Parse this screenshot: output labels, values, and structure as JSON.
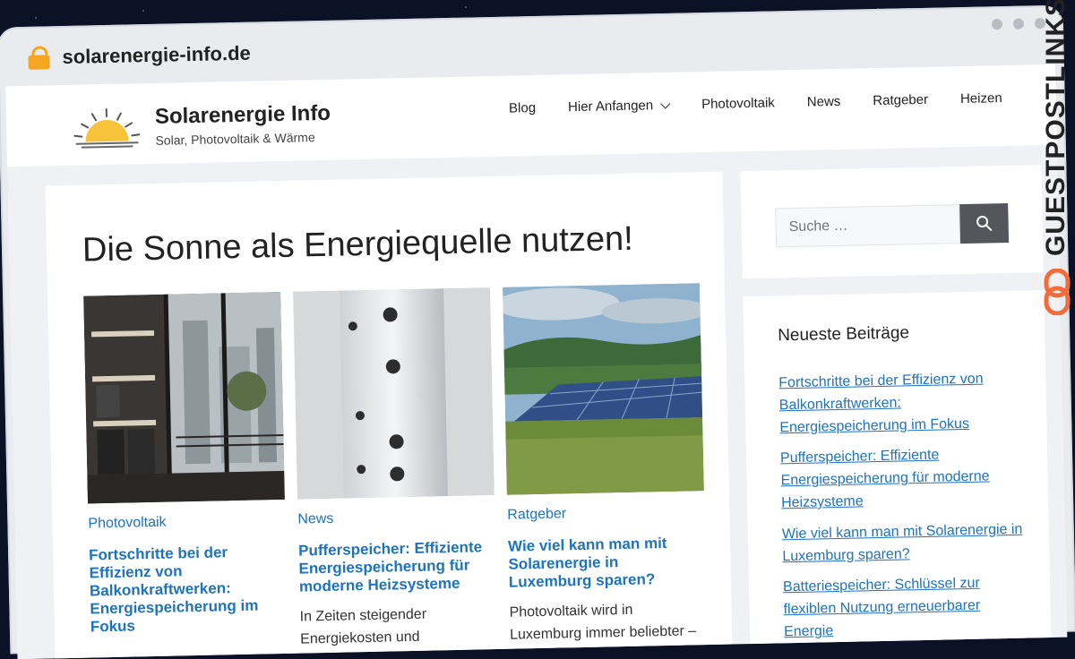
{
  "browser": {
    "url": "solarenergie-info.de"
  },
  "header": {
    "site_title": "Solarenergie Info",
    "site_description": "Solar, Photovoltaik & Wärme",
    "nav": [
      {
        "label": "Blog"
      },
      {
        "label": "Hier Anfangen",
        "has_dropdown": true
      },
      {
        "label": "Photovoltaik"
      },
      {
        "label": "News"
      },
      {
        "label": "Ratgeber"
      },
      {
        "label": "Heizen"
      }
    ]
  },
  "main": {
    "page_title": "Die Sonne als Energiequelle nutzen!",
    "posts": [
      {
        "category": "Photovoltaik",
        "title": "Fortschritte bei der Effizienz von Balkonkraftwerken: Energiespeicherung im Fokus",
        "excerpt": ""
      },
      {
        "category": "News",
        "title": "Pufferspeicher: Effiziente Energiespeicherung für moderne Heizsysteme",
        "excerpt": "In Zeiten steigender Energiekosten und"
      },
      {
        "category": "Ratgeber",
        "title": "Wie viel kann man mit Solarenergie in Luxemburg sparen?",
        "excerpt": "Photovoltaik wird in Luxemburg immer beliebter –"
      }
    ]
  },
  "sidebar": {
    "search_placeholder": "Suche …",
    "recent_title": "Neueste Beiträge",
    "recent_posts": [
      "Fortschritte bei der Effizienz von Balkonkraftwerken: Energiespeicherung im Fokus",
      "Pufferspeicher: Effiziente Energiespeicherung für moderne Heizsysteme",
      "Wie viel kann man mit Solarenergie in Luxemburg sparen?",
      "Batteriespeicher: Schlüssel zur flexiblen Nutzung erneuerbarer Energie"
    ]
  },
  "watermark": {
    "text": "GUESTPOSTLINKS"
  },
  "colors": {
    "link": "#1e73be",
    "lock": "#f5a623",
    "search_button": "#55555e",
    "watermark_accent": "#f26b3a"
  }
}
